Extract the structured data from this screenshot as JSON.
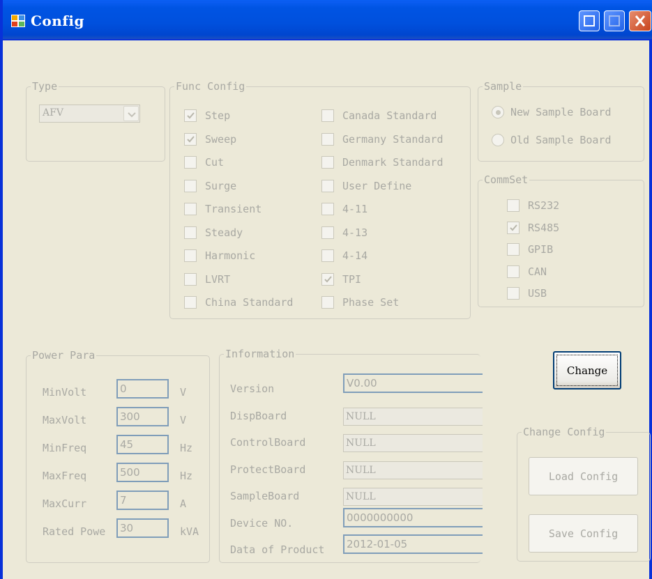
{
  "window": {
    "title": "Config"
  },
  "type_group": {
    "legend": "Type",
    "combo_value": "AFV"
  },
  "func_config": {
    "legend": "Func Config",
    "left": [
      {
        "label": "Step",
        "checked": true
      },
      {
        "label": "Sweep",
        "checked": true
      },
      {
        "label": "Cut",
        "checked": false
      },
      {
        "label": "Surge",
        "checked": false
      },
      {
        "label": "Transient",
        "checked": false
      },
      {
        "label": "Steady",
        "checked": false
      },
      {
        "label": "Harmonic",
        "checked": false
      },
      {
        "label": "LVRT",
        "checked": false
      },
      {
        "label": "China Standard",
        "checked": false
      }
    ],
    "right": [
      {
        "label": "Canada Standard",
        "checked": false
      },
      {
        "label": "Germany Standard",
        "checked": false
      },
      {
        "label": "Denmark Standard",
        "checked": false
      },
      {
        "label": "User Define",
        "checked": false
      },
      {
        "label": "4-11",
        "checked": false
      },
      {
        "label": "4-13",
        "checked": false
      },
      {
        "label": "4-14",
        "checked": false
      },
      {
        "label": "TPI",
        "checked": true
      },
      {
        "label": "Phase Set",
        "checked": false
      }
    ]
  },
  "sample": {
    "legend": "Sample",
    "options": [
      {
        "label": "New Sample Board",
        "selected": true
      },
      {
        "label": "Old Sample Board",
        "selected": false
      }
    ]
  },
  "commset": {
    "legend": "CommSet",
    "items": [
      {
        "label": "RS232",
        "checked": false
      },
      {
        "label": "RS485",
        "checked": true
      },
      {
        "label": "GPIB",
        "checked": false
      },
      {
        "label": "CAN",
        "checked": false
      },
      {
        "label": "USB",
        "checked": false
      }
    ]
  },
  "power_para": {
    "legend": "Power Para",
    "rows": [
      {
        "label": "MinVolt",
        "value": "0",
        "unit": "V"
      },
      {
        "label": "MaxVolt",
        "value": "300",
        "unit": "V"
      },
      {
        "label": "MinFreq",
        "value": "45",
        "unit": "Hz"
      },
      {
        "label": "MaxFreq",
        "value": "500",
        "unit": "Hz"
      },
      {
        "label": "MaxCurr",
        "value": "7",
        "unit": "A"
      },
      {
        "label": "Rated Powe",
        "value": "30",
        "unit": "kVA"
      }
    ]
  },
  "information": {
    "legend": "Information",
    "rows": [
      {
        "label": "Version",
        "value": "V0.00"
      },
      {
        "label": "DispBoard",
        "value": "NULL"
      },
      {
        "label": "ControlBoard",
        "value": "NULL"
      },
      {
        "label": "ProtectBoard",
        "value": "NULL"
      },
      {
        "label": "SampleBoard",
        "value": "NULL"
      },
      {
        "label": "Device NO.",
        "value": "0000000000"
      },
      {
        "label": "Data of Product",
        "value": "2012-01-05"
      }
    ]
  },
  "change_button": {
    "label": "Change"
  },
  "change_config": {
    "legend": "Change Config",
    "load_label": "Load Config",
    "save_label": "Save Config"
  },
  "colors": {
    "titlebar": "#0054e3",
    "face": "#ece9d8",
    "disabled_text": "#a9a9a3",
    "field_border": "#7f9db9"
  }
}
